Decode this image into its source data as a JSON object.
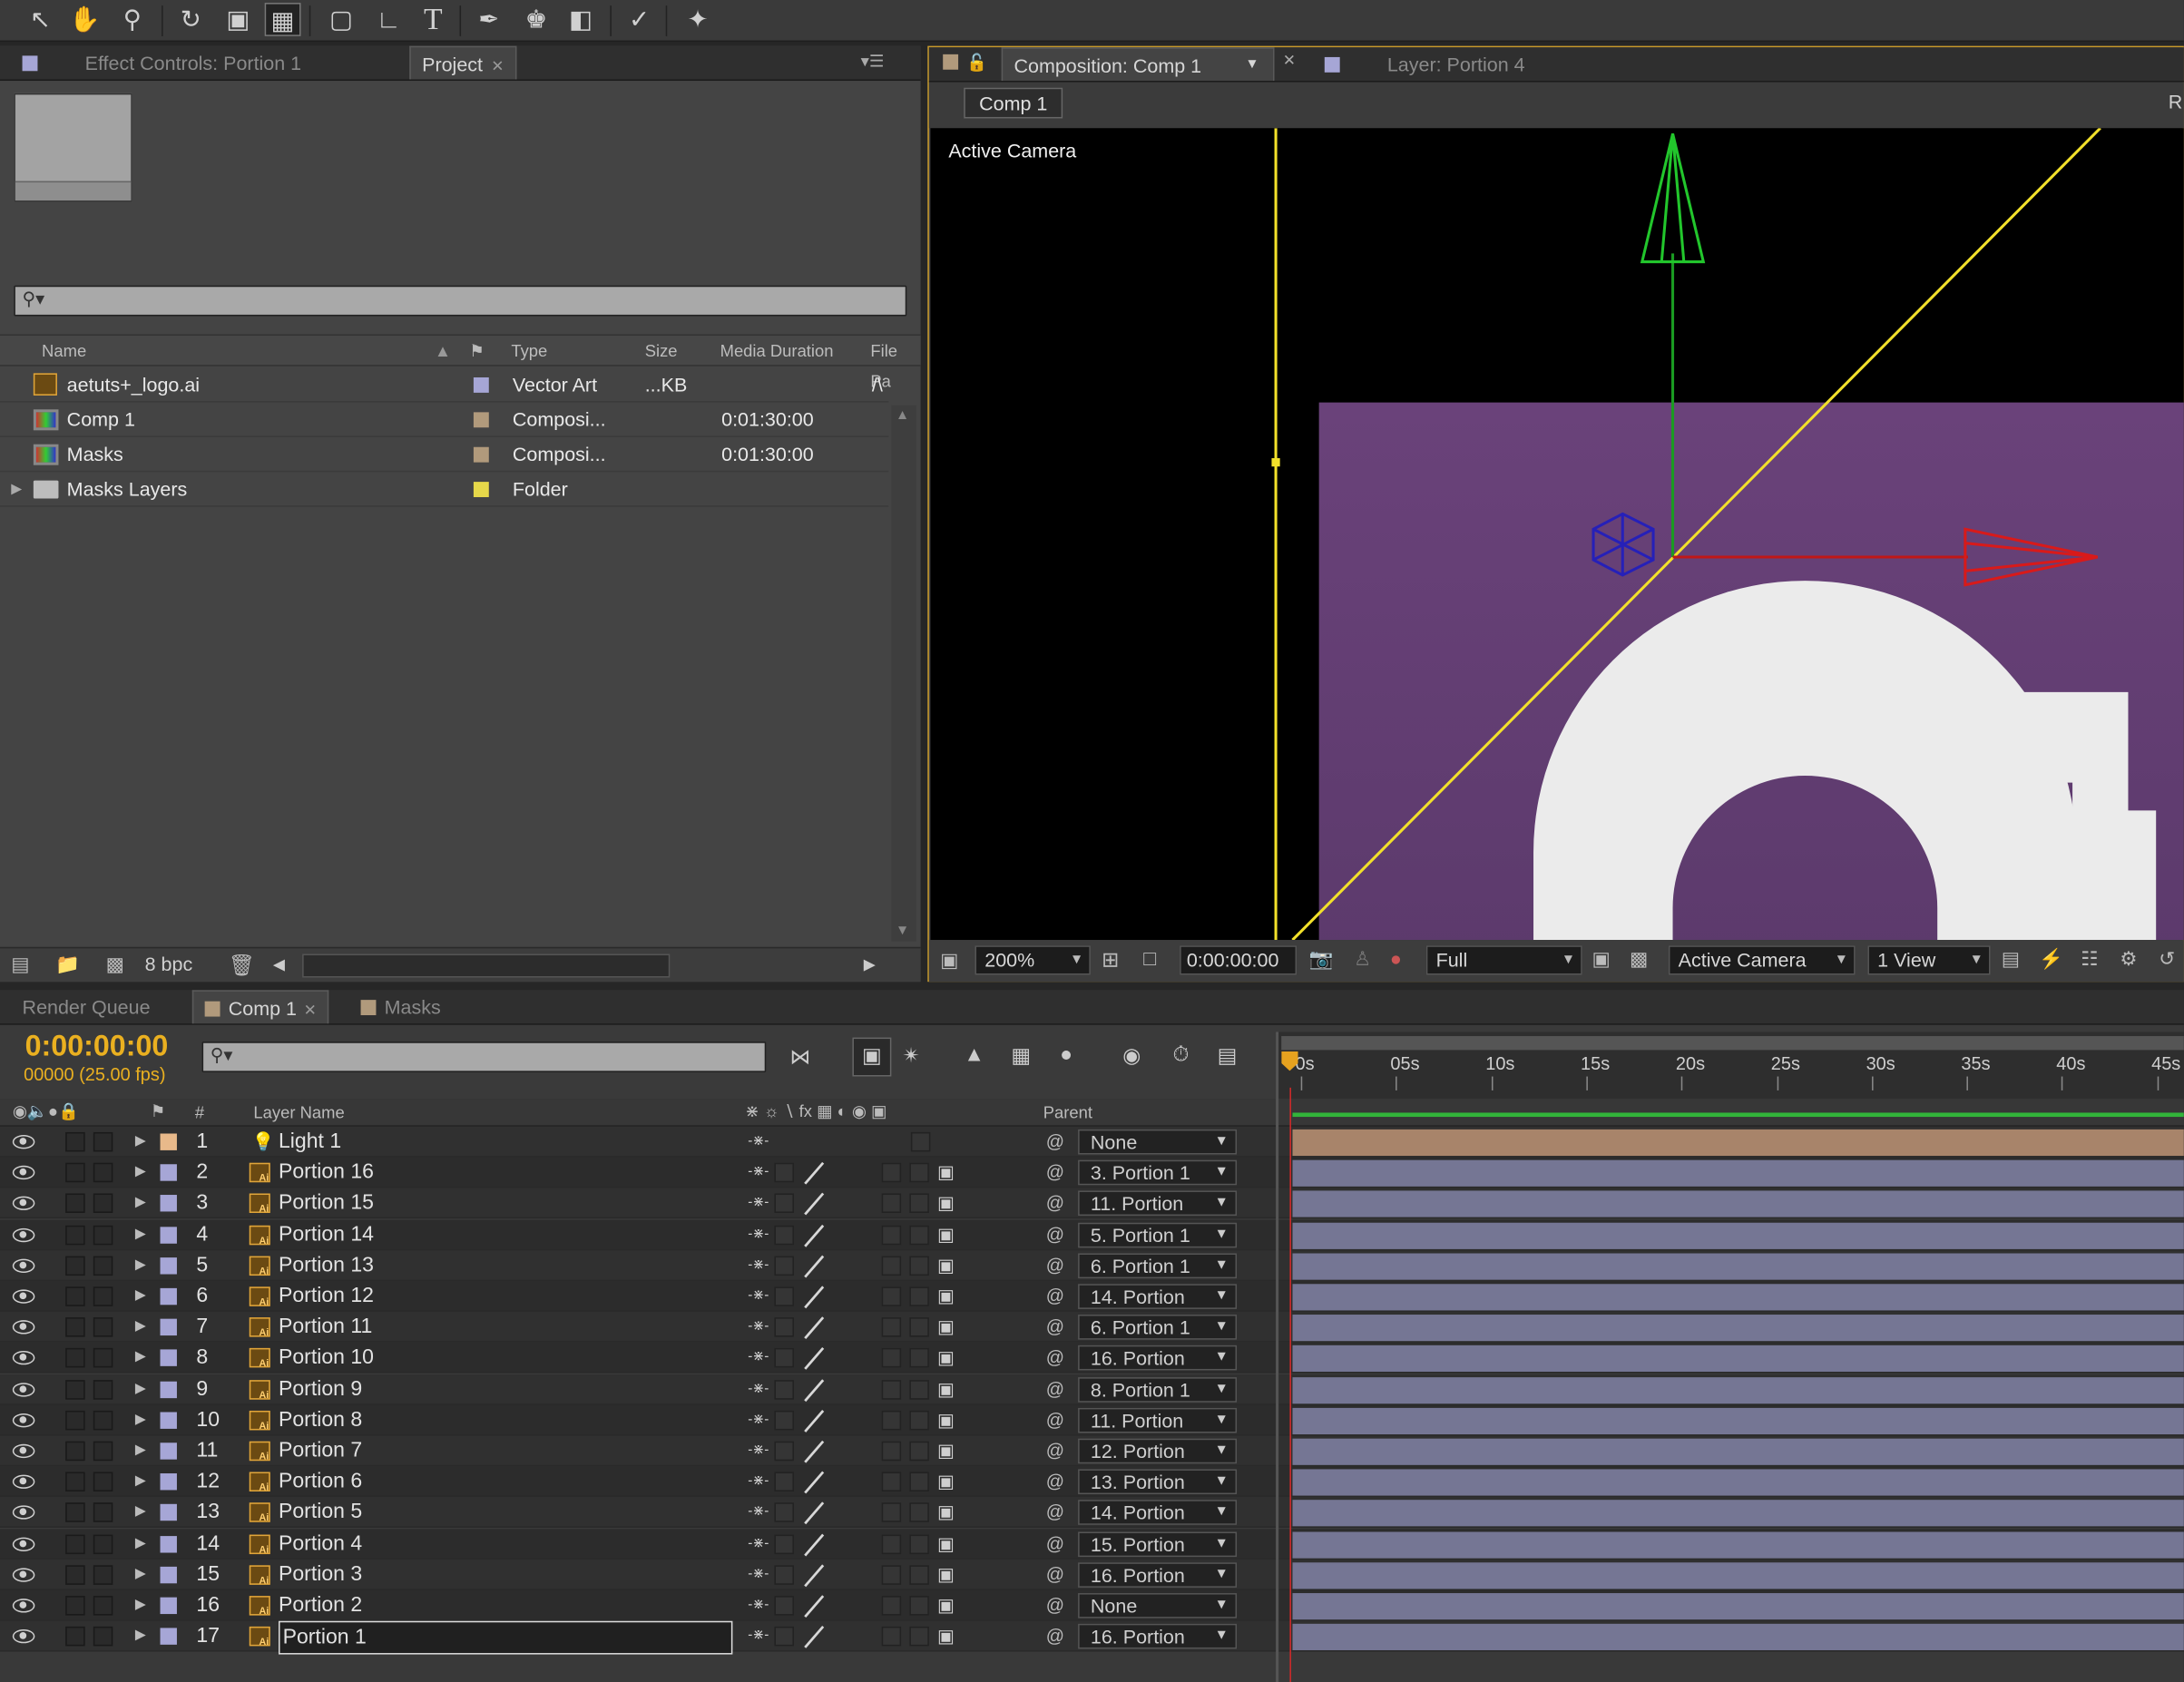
{
  "toolbar": {
    "tools": [
      "selection-tool",
      "hand-tool",
      "zoom-tool",
      "rotation-tool",
      "camera-tool",
      "pan-behind-tool",
      "rectangle-tool",
      "pen-tool",
      "type-tool",
      "brush-tool",
      "clone-stamp-tool",
      "eraser-tool",
      "roto-brush-tool",
      "puppet-pin-tool"
    ],
    "selected": "pan-behind-tool"
  },
  "left_panel": {
    "tab_effect": "Effect Controls: Portion 1",
    "tab_project": "Project",
    "columns": {
      "name": "Name",
      "type": "Type",
      "size": "Size",
      "duration": "Media Duration",
      "filepath": "File Pa"
    },
    "items": [
      {
        "name": "aetuts+_logo.ai",
        "type": "Vector Art",
        "size": "...KB",
        "duration": "",
        "path": "/\\",
        "label": "#a6a6d6",
        "icon": "illustrator-file-icon"
      },
      {
        "name": "Comp 1",
        "type": "Composi...",
        "size": "",
        "duration": "0:01:30:00",
        "path": "",
        "label": "#b19a7c",
        "icon": "composition-icon"
      },
      {
        "name": "Masks",
        "type": "Composi...",
        "size": "",
        "duration": "0:01:30:00",
        "path": "",
        "label": "#b19a7c",
        "icon": "composition-icon"
      },
      {
        "name": "Masks Layers",
        "type": "Folder",
        "size": "",
        "duration": "",
        "path": "",
        "label": "#e6d84a",
        "icon": "folder-icon"
      }
    ],
    "bpc": "8 bpc"
  },
  "composition": {
    "tab_comp": "Composition: Comp 1",
    "tab_layer": "Layer: Portion 4",
    "breadcrumb": "Comp 1",
    "edge_letter": "R",
    "view_label": "Active Camera",
    "zoom": "200%",
    "timecode": "0:00:00:00",
    "resolution": "Full",
    "camera": "Active Camera",
    "views": "1 View",
    "bg_color": "#5e3d6e"
  },
  "timeline": {
    "tab_render": "Render Queue",
    "tab_comp": "Comp 1",
    "tab_masks": "Masks",
    "timecode": "0:00:00:00",
    "frames": "00000 (25.00 fps)",
    "col_num": "#",
    "col_name": "Layer Name",
    "col_parent": "Parent",
    "ruler": [
      "0s",
      "05s",
      "10s",
      "15s",
      "20s",
      "25s",
      "30s",
      "35s",
      "40s",
      "45s"
    ],
    "layers": [
      {
        "num": "1",
        "name": "Light 1",
        "parent": "None",
        "kind": "light",
        "label": "#e8b98a"
      },
      {
        "num": "2",
        "name": "Portion 16",
        "parent": "3. Portion 1",
        "kind": "ai",
        "label": "#a6a6d6"
      },
      {
        "num": "3",
        "name": "Portion 15",
        "parent": "11. Portion",
        "kind": "ai",
        "label": "#a6a6d6"
      },
      {
        "num": "4",
        "name": "Portion 14",
        "parent": "5. Portion 1",
        "kind": "ai",
        "label": "#a6a6d6"
      },
      {
        "num": "5",
        "name": "Portion 13",
        "parent": "6. Portion 1",
        "kind": "ai",
        "label": "#a6a6d6"
      },
      {
        "num": "6",
        "name": "Portion 12",
        "parent": "14. Portion",
        "kind": "ai",
        "label": "#a6a6d6"
      },
      {
        "num": "7",
        "name": "Portion 11",
        "parent": "6. Portion 1",
        "kind": "ai",
        "label": "#a6a6d6"
      },
      {
        "num": "8",
        "name": "Portion 10",
        "parent": "16. Portion",
        "kind": "ai",
        "label": "#a6a6d6"
      },
      {
        "num": "9",
        "name": "Portion 9",
        "parent": "8. Portion 1",
        "kind": "ai",
        "label": "#a6a6d6"
      },
      {
        "num": "10",
        "name": "Portion 8",
        "parent": "11. Portion",
        "kind": "ai",
        "label": "#a6a6d6"
      },
      {
        "num": "11",
        "name": "Portion 7",
        "parent": "12. Portion",
        "kind": "ai",
        "label": "#a6a6d6"
      },
      {
        "num": "12",
        "name": "Portion 6",
        "parent": "13. Portion",
        "kind": "ai",
        "label": "#a6a6d6"
      },
      {
        "num": "13",
        "name": "Portion 5",
        "parent": "14. Portion",
        "kind": "ai",
        "label": "#a6a6d6"
      },
      {
        "num": "14",
        "name": "Portion 4",
        "parent": "15. Portion",
        "kind": "ai",
        "label": "#a6a6d6"
      },
      {
        "num": "15",
        "name": "Portion 3",
        "parent": "16. Portion",
        "kind": "ai",
        "label": "#a6a6d6"
      },
      {
        "num": "16",
        "name": "Portion 2",
        "parent": "None",
        "kind": "ai",
        "label": "#a6a6d6"
      },
      {
        "num": "17",
        "name": "Portion 1",
        "parent": "16. Portion",
        "kind": "ai",
        "label": "#a6a6d6",
        "selected": true
      }
    ]
  }
}
